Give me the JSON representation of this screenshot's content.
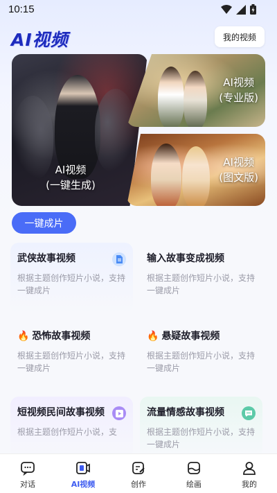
{
  "status": {
    "time": "10:15"
  },
  "header": {
    "logo": "AI视频",
    "my_videos": "我的视频"
  },
  "banners": {
    "main": {
      "line1": "AI视频",
      "line2": "(一键生成)"
    },
    "pro": {
      "line1": "AI视频",
      "line2": "(专业版)"
    },
    "picture_text": {
      "line1": "AI视频",
      "line2": "(图文版)"
    }
  },
  "one_click_button": "一键成片",
  "cards": [
    {
      "title": "武侠故事视频",
      "desc": "根据主题创作短片小说，支持一键成片",
      "icon": "document-icon"
    },
    {
      "title": "输入故事变成视频",
      "desc": "根据主题创作短片小说，支持一键成片"
    },
    {
      "title": "恐怖故事视频",
      "desc": "根据主题创作短片小说，支持一键成片",
      "icon": "fire-icon"
    },
    {
      "title": "悬疑故事视频",
      "desc": "根据主题创作短片小说，支持一键成片",
      "icon": "fire-icon"
    },
    {
      "title": "短视频民间故事视频",
      "desc": "根据主题创作短片小说，支",
      "icon": "play-icon"
    },
    {
      "title": "流量情感故事视频",
      "desc": "根据主题创作短片小说，支持一键成片",
      "icon": "chat-icon"
    }
  ],
  "colors": {
    "accent": "#4a6cf7",
    "logo": "#1d2bbd"
  },
  "tabbar": [
    {
      "label": "对话",
      "icon": "chat-bubble-icon"
    },
    {
      "label": "AI视频",
      "icon": "video-icon",
      "active": true
    },
    {
      "label": "创作",
      "icon": "edit-icon"
    },
    {
      "label": "绘画",
      "icon": "paint-icon"
    },
    {
      "label": "我的",
      "icon": "user-icon"
    }
  ]
}
